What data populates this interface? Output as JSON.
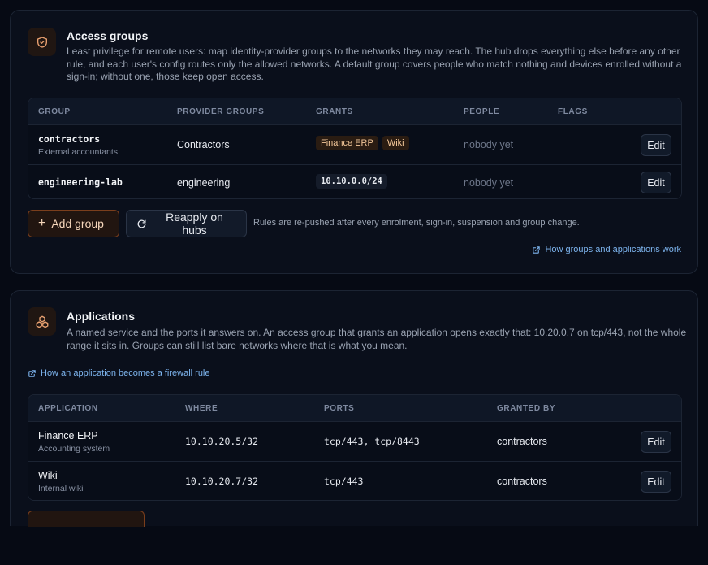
{
  "access_groups": {
    "title": "Access groups",
    "icon": "shield-check-icon",
    "description": "Least privilege for remote users: map identity-provider groups to the networks they may reach. The hub drops everything else before any other rule, and each user's config routes only the allowed networks. A default group covers people who match nothing and devices enrolled without a sign-in; without one, those keep open access.",
    "columns": [
      "Group",
      "Provider groups",
      "Grants",
      "People",
      "Flags"
    ],
    "rows": [
      {
        "group": "contractors",
        "group_sub": "External accountants",
        "provider_groups": "Contractors",
        "grants": [
          "Finance ERP",
          "Wiki"
        ],
        "people": "nobody yet",
        "flags": "",
        "edit_label": "Edit"
      },
      {
        "group": "engineering-lab",
        "group_sub": "",
        "provider_groups": "engineering",
        "grants_code": "10.10.0.0/24",
        "people": "nobody yet",
        "flags": "",
        "edit_label": "Edit"
      }
    ],
    "add_button": "Add group",
    "reapply_button": "Reapply on hubs",
    "hint": "Rules are re-pushed after every enrolment, sign-in, suspension and group change.",
    "help_link": "How groups and applications work"
  },
  "applications": {
    "title": "Applications",
    "icon": "cubes-icon",
    "description": "A named service and the ports it answers on. An access group that grants an application opens exactly that: 10.20.0.7 on tcp/443, not the whole range it sits in. Groups can still list bare networks where that is what you mean.",
    "help_link": "How an application becomes a firewall rule",
    "columns": [
      "Application",
      "Where",
      "Ports",
      "Granted by"
    ],
    "rows": [
      {
        "name": "Finance ERP",
        "sub": "Accounting system",
        "where": "10.10.20.5/32",
        "ports": "tcp/443, tcp/8443",
        "granted_by": "contractors",
        "edit_label": "Edit"
      },
      {
        "name": "Wiki",
        "sub": "Internal wiki",
        "where": "10.10.20.7/32",
        "ports": "tcp/443",
        "granted_by": "contractors",
        "edit_label": "Edit"
      }
    ]
  },
  "colors": {
    "accent": "#e8a070",
    "link": "#7db4ee",
    "background": "#060a14",
    "card": "#0a0f1b"
  }
}
